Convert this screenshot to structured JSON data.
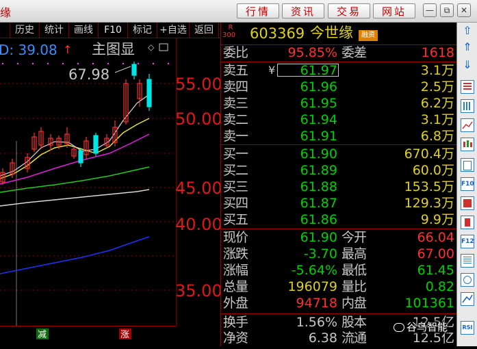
{
  "window": {
    "title_fragment": "缘",
    "buttons": [
      "行情",
      "资讯",
      "交易",
      "网站"
    ]
  },
  "menu": [
    "历史",
    "统计",
    "画线",
    "F10",
    "标记",
    "+自选",
    "返回"
  ],
  "chart": {
    "header_value": "D: 39.08",
    "header_arrow": "↑",
    "main_label": "主图显",
    "high_marker": "67.98",
    "price_axis": [
      "55.00",
      "50.00",
      "45.00",
      "40.00",
      "35.00"
    ],
    "vol_tags": [
      "减",
      "涨"
    ]
  },
  "stock": {
    "badge_top": "R",
    "badge_bottom": "300",
    "code": "603369",
    "name": "今世缘",
    "tag": "融资融券"
  },
  "quote": {
    "weibi_label": "委比",
    "weibi_value": "95.85%",
    "weicha_label": "委差",
    "weicha_value": "1618",
    "currency": "¥",
    "sell": [
      {
        "label": "卖五",
        "price": "61.97",
        "vol": "3.1万"
      },
      {
        "label": "卖四",
        "price": "61.96",
        "vol": "2.5万"
      },
      {
        "label": "卖三",
        "price": "61.95",
        "vol": "6.2万"
      },
      {
        "label": "卖二",
        "price": "61.94",
        "vol": "3.1万"
      },
      {
        "label": "卖一",
        "price": "61.91",
        "vol": "6.8万"
      }
    ],
    "buy": [
      {
        "label": "买一",
        "price": "61.90",
        "vol": "670.4万"
      },
      {
        "label": "买二",
        "price": "61.89",
        "vol": "60.0万"
      },
      {
        "label": "买三",
        "price": "61.88",
        "vol": "153.5万"
      },
      {
        "label": "买四",
        "price": "61.87",
        "vol": "129.3万"
      },
      {
        "label": "买五",
        "price": "61.86",
        "vol": "9.9万"
      }
    ],
    "stats": [
      {
        "l1": "现价",
        "v1": "61.90",
        "c1": "#00d000",
        "l2": "今开",
        "v2": "66.04",
        "c2": "#ff3030"
      },
      {
        "l1": "涨跌",
        "v1": "-3.70",
        "c1": "#00d000",
        "l2": "最高",
        "v2": "67.00",
        "c2": "#ff3030"
      },
      {
        "l1": "涨幅",
        "v1": "-5.64%",
        "c1": "#00d000",
        "l2": "最低",
        "v2": "61.45",
        "c2": "#00d000"
      },
      {
        "l1": "总量",
        "v1": "196079",
        "c1": "#e0d020",
        "l2": "量比",
        "v2": "0.82",
        "c2": "#00d000"
      },
      {
        "l1": "外盘",
        "v1": "94718",
        "c1": "#ff3030",
        "l2": "内盘",
        "v2": "101361",
        "c2": "#00d000"
      }
    ],
    "stats2": [
      {
        "l1": "换手",
        "v1": "1.56%",
        "c1": "#c8c8c8",
        "l2": "股本",
        "v2": "12.5亿",
        "c2": "#c8c8c8"
      },
      {
        "l1": "净资",
        "v1": "6.38",
        "c1": "#c8c8c8",
        "l2": "流通",
        "v2": "12.5亿",
        "c2": "#c8c8c8"
      }
    ]
  },
  "watermark": "谷鸟智能",
  "toolbar": [
    "F10",
    "F12",
    "RSI"
  ],
  "colors": {
    "up": "#ff3030",
    "down": "#00d000",
    "vol": "#e0d020",
    "cyan": "#00e5e5"
  }
}
